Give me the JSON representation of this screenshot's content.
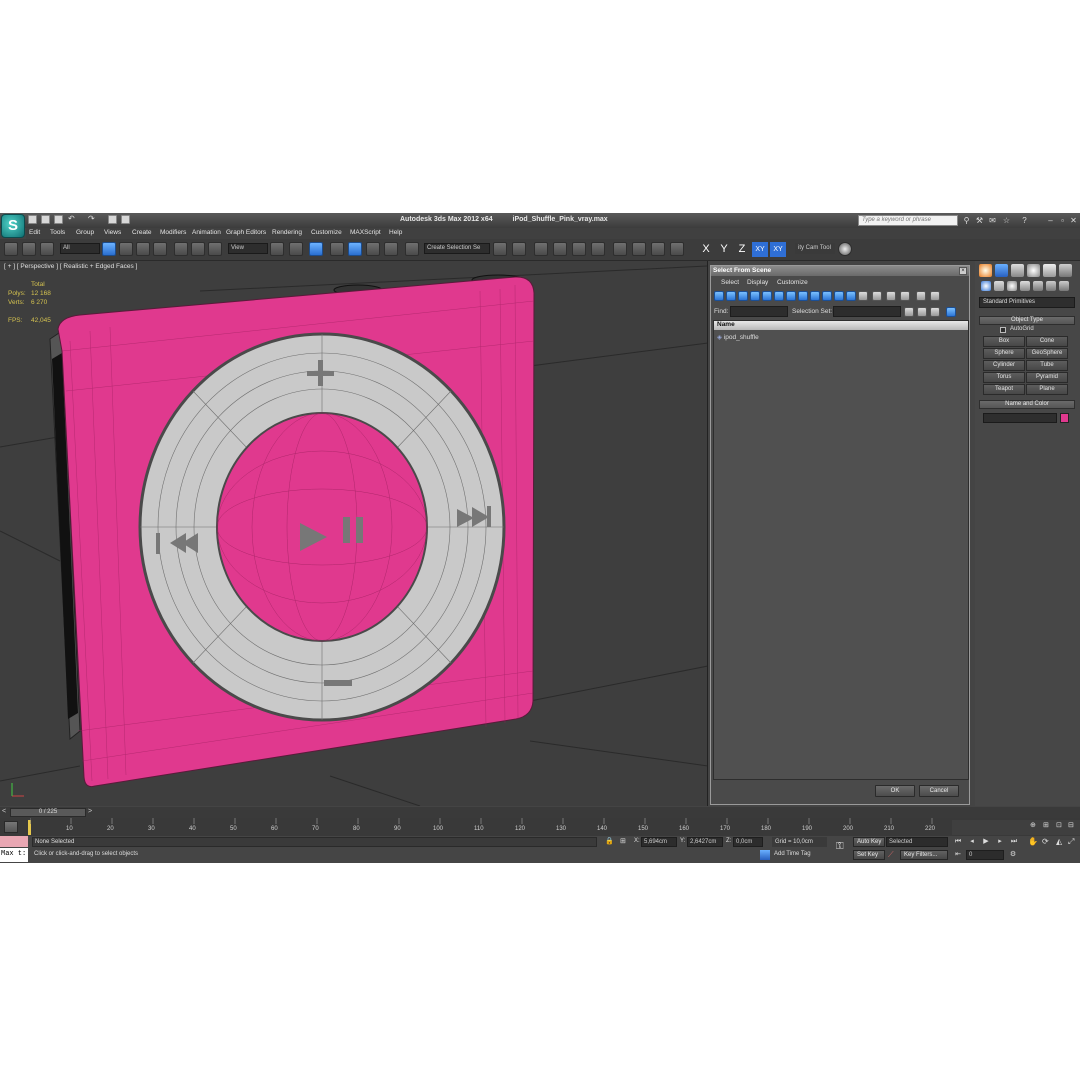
{
  "window": {
    "app_title": "Autodesk 3ds Max  2012 x64",
    "file_name": "iPod_Shuffle_Pink_vray.max",
    "search_placeholder": "Type a keyword or phrase"
  },
  "menu": [
    "Edit",
    "Tools",
    "Group",
    "Views",
    "Create",
    "Modifiers",
    "Animation",
    "Graph Editors",
    "Rendering",
    "Customize",
    "MAXScript",
    "Help"
  ],
  "toolbar": {
    "filter_dropdown": "All",
    "coord_dropdown": "View",
    "selection_set": "Create Selection Se",
    "axis_x": "X",
    "axis_y": "Y",
    "axis_z": "Z",
    "axis_xy": "XY",
    "axis_xy2": "XY",
    "cam_tool": "ity Cam Tool"
  },
  "viewport": {
    "label": "[ + ] [ Perspective ] [ Realistic + Edged Faces ]",
    "stats": {
      "total_label": "Total",
      "polys_label": "Polys:",
      "polys_value": "12 168",
      "verts_label": "Verts:",
      "verts_value": "6 270",
      "fps_label": "FPS:",
      "fps_value": "42,045"
    },
    "colors": {
      "body": "#e0398e",
      "ring": "#c9c9c9",
      "background": "#3e3e3e"
    }
  },
  "select_dialog": {
    "title": "Select From Scene",
    "menu": [
      "Select",
      "Display",
      "Customize"
    ],
    "find_label": "Find:",
    "selection_set_label": "Selection Set:",
    "column_name": "Name",
    "items": [
      "ipod_shuffle"
    ],
    "ok": "OK",
    "cancel": "Cancel"
  },
  "command_panel": {
    "category": "Standard Primitives",
    "object_type_header": "Object Type",
    "autogrid_label": "AutoGrid",
    "primitives": [
      "Box",
      "Cone",
      "Sphere",
      "GeoSphere",
      "Cylinder",
      "Tube",
      "Torus",
      "Pyramid",
      "Teapot",
      "Plane"
    ],
    "name_color_header": "Name and Color",
    "object_color": "#e0398e"
  },
  "timeline": {
    "frame_counter": "0 / 225",
    "ticks": [
      "10",
      "20",
      "30",
      "40",
      "50",
      "60",
      "70",
      "80",
      "90",
      "100",
      "110",
      "120",
      "130",
      "140",
      "150",
      "160",
      "170",
      "180",
      "190",
      "200",
      "210",
      "220"
    ]
  },
  "status": {
    "maxscript": "Max t:",
    "selection": "None Selected",
    "prompt": "Click or click-and-drag to select objects",
    "x_label": "X:",
    "x_value": "5,694cm",
    "y_label": "Y:",
    "y_value": "2,6427cm",
    "z_label": "Z:",
    "z_value": "0,0cm",
    "grid": "Grid = 10,0cm",
    "add_time_tag": "Add Time Tag",
    "auto_key": "Auto Key",
    "set_key": "Set Key",
    "selected_dropdown": "Selected",
    "key_filters": "Key Filters...",
    "frame_field": "0"
  }
}
